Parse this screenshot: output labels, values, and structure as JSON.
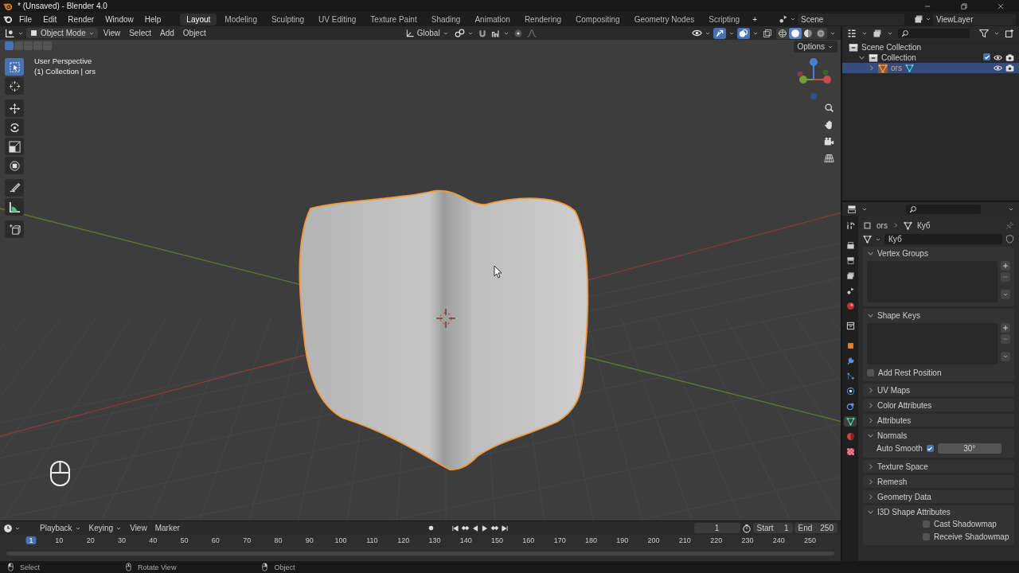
{
  "window": {
    "title": "* (Unsaved) - Blender 4.0"
  },
  "menus": [
    "File",
    "Edit",
    "Render",
    "Window",
    "Help"
  ],
  "workspaces": [
    {
      "label": "Layout",
      "selected": true
    },
    {
      "label": "Modeling",
      "selected": false
    },
    {
      "label": "Sculpting",
      "selected": false
    },
    {
      "label": "UV Editing",
      "selected": false
    },
    {
      "label": "Texture Paint",
      "selected": false
    },
    {
      "label": "Shading",
      "selected": false
    },
    {
      "label": "Animation",
      "selected": false
    },
    {
      "label": "Rendering",
      "selected": false
    },
    {
      "label": "Compositing",
      "selected": false
    },
    {
      "label": "Geometry Nodes",
      "selected": false
    },
    {
      "label": "Scripting",
      "selected": false
    }
  ],
  "add_workspace": "+",
  "scene": "Scene",
  "view_layer": "ViewLayer",
  "viewport": {
    "mode": "Object Mode",
    "menus": [
      "View",
      "Select",
      "Add",
      "Object"
    ],
    "orientation": "Global",
    "snap": {
      "on": false
    },
    "proportional": {
      "on": false
    },
    "gizmos": {
      "on": true
    },
    "overlays": {
      "on": true
    },
    "xray": {
      "on": false
    },
    "shading": [
      {
        "kind": "wireframe",
        "selected": false
      },
      {
        "kind": "solid",
        "selected": true
      },
      {
        "kind": "material",
        "selected": false
      },
      {
        "kind": "rendered",
        "selected": false
      }
    ],
    "select_modes": [
      {
        "selected": true
      },
      {
        "selected": false
      },
      {
        "selected": false
      },
      {
        "selected": false
      },
      {
        "selected": false
      }
    ],
    "options": "Options",
    "info": [
      "User Perspective",
      "(1) Collection | ors"
    ],
    "tools": [
      {
        "kind": "select",
        "selected": true
      },
      {
        "kind": "cursor",
        "selected": false
      },
      {
        "kind": "move",
        "selected": false
      },
      {
        "kind": "rotate",
        "selected": false
      },
      {
        "kind": "scale",
        "selected": false
      },
      {
        "kind": "transform",
        "selected": false
      },
      {
        "kind": "annotate",
        "selected": false
      },
      {
        "kind": "measure",
        "selected": false
      },
      {
        "kind": "add_cube",
        "selected": false
      }
    ]
  },
  "outliner": {
    "items": [
      {
        "kind": "scene_collection",
        "label": "Scene Collection",
        "children": [
          {
            "kind": "collection",
            "label": "Collection",
            "expanded": true,
            "checked": true,
            "selected": false,
            "children": [
              {
                "kind": "mesh_object",
                "label": "ors",
                "expanded": false,
                "selected": true
              }
            ]
          }
        ]
      }
    ]
  },
  "properties": {
    "breadcrumb": [
      "ors",
      "Куб"
    ],
    "mesh_name": "Куб",
    "tabs": [
      {
        "kind": "tool",
        "selected": false
      },
      {
        "kind": "render",
        "selected": false
      },
      {
        "kind": "output",
        "selected": false
      },
      {
        "kind": "view_layer",
        "selected": false
      },
      {
        "kind": "scene",
        "selected": false
      },
      {
        "kind": "world",
        "selected": false
      },
      {
        "kind": "collection",
        "selected": false
      },
      {
        "kind": "object",
        "selected": false
      },
      {
        "kind": "modifiers",
        "selected": false
      },
      {
        "kind": "particles",
        "selected": false
      },
      {
        "kind": "physics",
        "selected": false
      },
      {
        "kind": "constraints",
        "selected": false
      },
      {
        "kind": "data",
        "selected": true
      },
      {
        "kind": "material",
        "selected": false
      },
      {
        "kind": "texture",
        "selected": false
      }
    ],
    "panels": [
      {
        "kind": "list",
        "title": "Vertex Groups",
        "expanded": true
      },
      {
        "kind": "list",
        "title": "Shape Keys",
        "expanded": true,
        "checkbox": {
          "label": "Add Rest Position",
          "checked": false
        }
      },
      {
        "title": "UV Maps",
        "expanded": false
      },
      {
        "title": "Color Attributes",
        "expanded": false
      },
      {
        "title": "Attributes",
        "expanded": false
      },
      {
        "kind": "normals",
        "title": "Normals",
        "expanded": true,
        "auto_smooth": {
          "label": "Auto Smooth",
          "checked": true,
          "value": "30°"
        }
      },
      {
        "title": "Texture Space",
        "expanded": false
      },
      {
        "title": "Remesh",
        "expanded": false
      },
      {
        "title": "Geometry Data",
        "expanded": false
      },
      {
        "kind": "checks",
        "title": "I3D Shape Attributes",
        "expanded": true,
        "items": [
          {
            "label": "Cast Shadowmap",
            "checked": false
          },
          {
            "label": "Receive Shadowmap",
            "checked": false
          }
        ]
      }
    ]
  },
  "timeline": {
    "menus": [
      "Playback",
      "Keying",
      "View",
      "Marker"
    ],
    "auto_key": {
      "on": false
    },
    "current_frame": "1",
    "start_label": "Start",
    "start": "1",
    "end_label": "End",
    "end": "250",
    "ticks": [
      "1",
      "10",
      "20",
      "30",
      "40",
      "50",
      "60",
      "70",
      "80",
      "90",
      "100",
      "110",
      "120",
      "130",
      "140",
      "150",
      "160",
      "170",
      "180",
      "190",
      "200",
      "210",
      "220",
      "230",
      "240",
      "250"
    ]
  },
  "status_bar": [
    {
      "kind": "left",
      "label": "Select"
    },
    {
      "kind": "middle",
      "label": "Rotate View"
    },
    {
      "kind": "right",
      "label": "Object"
    }
  ]
}
